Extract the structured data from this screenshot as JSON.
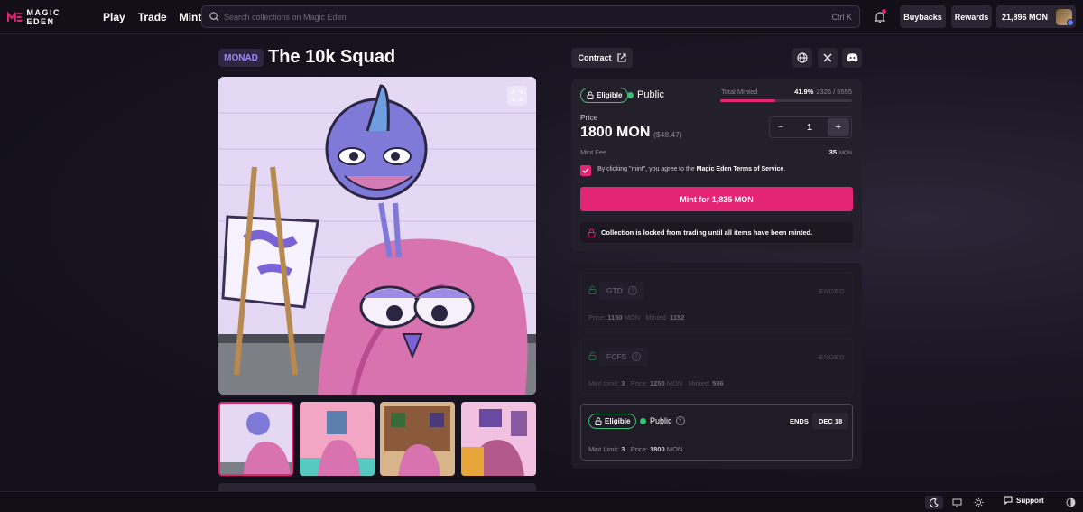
{
  "nav": {
    "brand": "MAGIC EDEN",
    "links": [
      "Play",
      "Trade",
      "Mint"
    ],
    "search_placeholder": "Search collections on Magic Eden",
    "search_shortcut": "Ctrl K",
    "buybacks": "Buybacks",
    "rewards": "Rewards",
    "balance": "21,896 MON"
  },
  "collection": {
    "chain": "MONAD",
    "name": "The 10k Squad",
    "contract_label": "Contract"
  },
  "mint": {
    "eligible": "Eligible",
    "phase": "Public",
    "total_minted_label": "Total Minted",
    "total_minted_pct": "41.9%",
    "total_minted_count": "2326 / 5555",
    "progress_fraction": 0.419,
    "price_label": "Price",
    "price": "1800 MON",
    "price_usd": "($48.47)",
    "quantity": "1",
    "minus": "−",
    "plus": "+",
    "fee_label": "Mint Fee",
    "fee_value": "35",
    "fee_unit": "MON",
    "terms_prefix": "By clicking \"mint\", you agree to the ",
    "terms_link": "Magic Eden Terms of Service",
    "terms_suffix": ".",
    "mint_button": "Mint for 1,835 MON",
    "lock_notice": "Collection is locked from trading until all items have been minted."
  },
  "phases": [
    {
      "name": "GTD",
      "status": "ENDED",
      "price_label": "Price:",
      "price": "1150",
      "unit": "MON",
      "minted_label": "Minted:",
      "minted": "1152"
    },
    {
      "name": "FCFS",
      "status": "ENDED",
      "limit_label": "Mint Limit:",
      "limit": "3",
      "price_label": "Price:",
      "price": "1250",
      "unit": "MON",
      "minted_label": "Minted:",
      "minted": "596"
    },
    {
      "name": "Public",
      "eligible": "Eligible",
      "ends_label": "ENDS",
      "ends_date": "DEC 18",
      "limit_label": "Mint Limit:",
      "limit": "3",
      "price_label": "Price:",
      "price": "1800",
      "unit": "MON"
    }
  ],
  "footer": {
    "support": "Support"
  },
  "colors": {
    "accent": "#e42575",
    "eligible": "#35c26f",
    "chain": "#9f87ff"
  }
}
